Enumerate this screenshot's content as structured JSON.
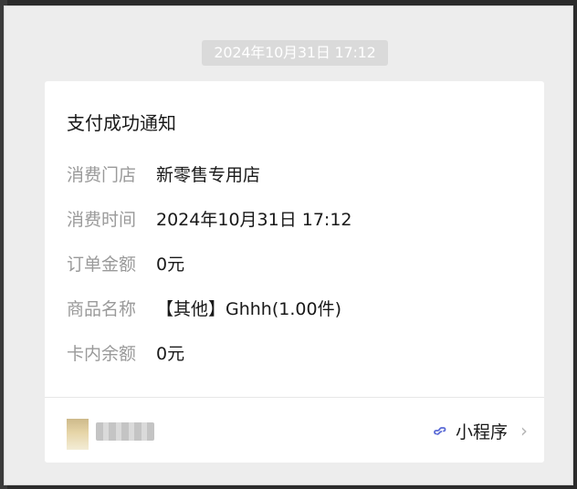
{
  "timestamp": "2024年10月31日 17:12",
  "card": {
    "title": "支付成功通知",
    "rows": [
      {
        "label": "消费门店",
        "value": "新零售专用店"
      },
      {
        "label": "消费时间",
        "value": "2024年10月31日 17:12"
      },
      {
        "label": "订单金额",
        "value": "0元"
      },
      {
        "label": "商品名称",
        "value": "【其他】Ghhh(1.00件)"
      },
      {
        "label": "卡内余额",
        "value": "0元"
      }
    ],
    "footer": {
      "mini_program_label": "小程序",
      "link_icon": "mini-program-link-icon",
      "chevron_icon": "chevron-right-icon"
    }
  },
  "colors": {
    "window_bg": "#ededed",
    "card_bg": "#ffffff",
    "label": "#9a9a9a",
    "value": "#191919",
    "accent_link": "#5b6bd6"
  }
}
